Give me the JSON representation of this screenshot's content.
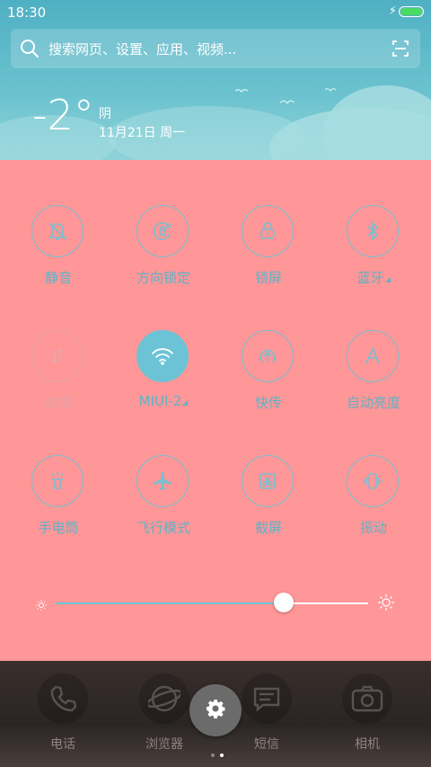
{
  "status": {
    "time": "18:30",
    "battery_level": 1.0,
    "charging_symbol": "⚡"
  },
  "search": {
    "placeholder": "搜索网页、设置、应用、视频...",
    "icon": "search-icon",
    "scan_icon": "scan-icon"
  },
  "weather": {
    "temperature": "-2°",
    "condition": "阴",
    "date": "11月21日 周一"
  },
  "quick_settings": [
    {
      "id": "mute",
      "label": "静音",
      "icon": "bell-off-icon",
      "state": "off"
    },
    {
      "id": "rotation-lock",
      "label": "方向锁定",
      "icon": "rotation-lock-icon",
      "state": "off"
    },
    {
      "id": "lock-screen",
      "label": "锁屏",
      "icon": "lock-icon",
      "state": "off"
    },
    {
      "id": "bluetooth",
      "label": "蓝牙",
      "icon": "bluetooth-icon",
      "state": "off",
      "expandable": true
    },
    {
      "id": "data",
      "label": "数据",
      "icon": "data-arrows-icon",
      "state": "disabled"
    },
    {
      "id": "wifi",
      "label": "MIUI-2",
      "icon": "wifi-icon",
      "state": "on",
      "expandable": true
    },
    {
      "id": "quick-send",
      "label": "快传",
      "icon": "upload-circle-icon",
      "state": "off"
    },
    {
      "id": "auto-brightness",
      "label": "自动亮度",
      "icon": "letter-a-icon",
      "state": "off"
    },
    {
      "id": "flashlight",
      "label": "手电筒",
      "icon": "flashlight-icon",
      "state": "off"
    },
    {
      "id": "airplane",
      "label": "飞行模式",
      "icon": "airplane-icon",
      "state": "off"
    },
    {
      "id": "screenshot",
      "label": "截屏",
      "icon": "scissors-icon",
      "state": "off"
    },
    {
      "id": "vibrate",
      "label": "振动",
      "icon": "vibrate-icon",
      "state": "off"
    }
  ],
  "brightness": {
    "value": 0.73,
    "low_icon": "sun-small-icon",
    "high_icon": "sun-large-icon"
  },
  "dock": {
    "apps": [
      {
        "label": "电话",
        "icon": "phone-icon"
      },
      {
        "label": "浏览器",
        "icon": "browser-icon"
      },
      {
        "label": "短信",
        "icon": "message-icon"
      },
      {
        "label": "相机",
        "icon": "camera-icon"
      }
    ],
    "settings_icon": "gear-icon",
    "page_count": 2,
    "active_page": 1
  },
  "colors": {
    "panel": "#ff9698",
    "accent": "#6cc3d5",
    "sky": "#5bb6c7"
  }
}
